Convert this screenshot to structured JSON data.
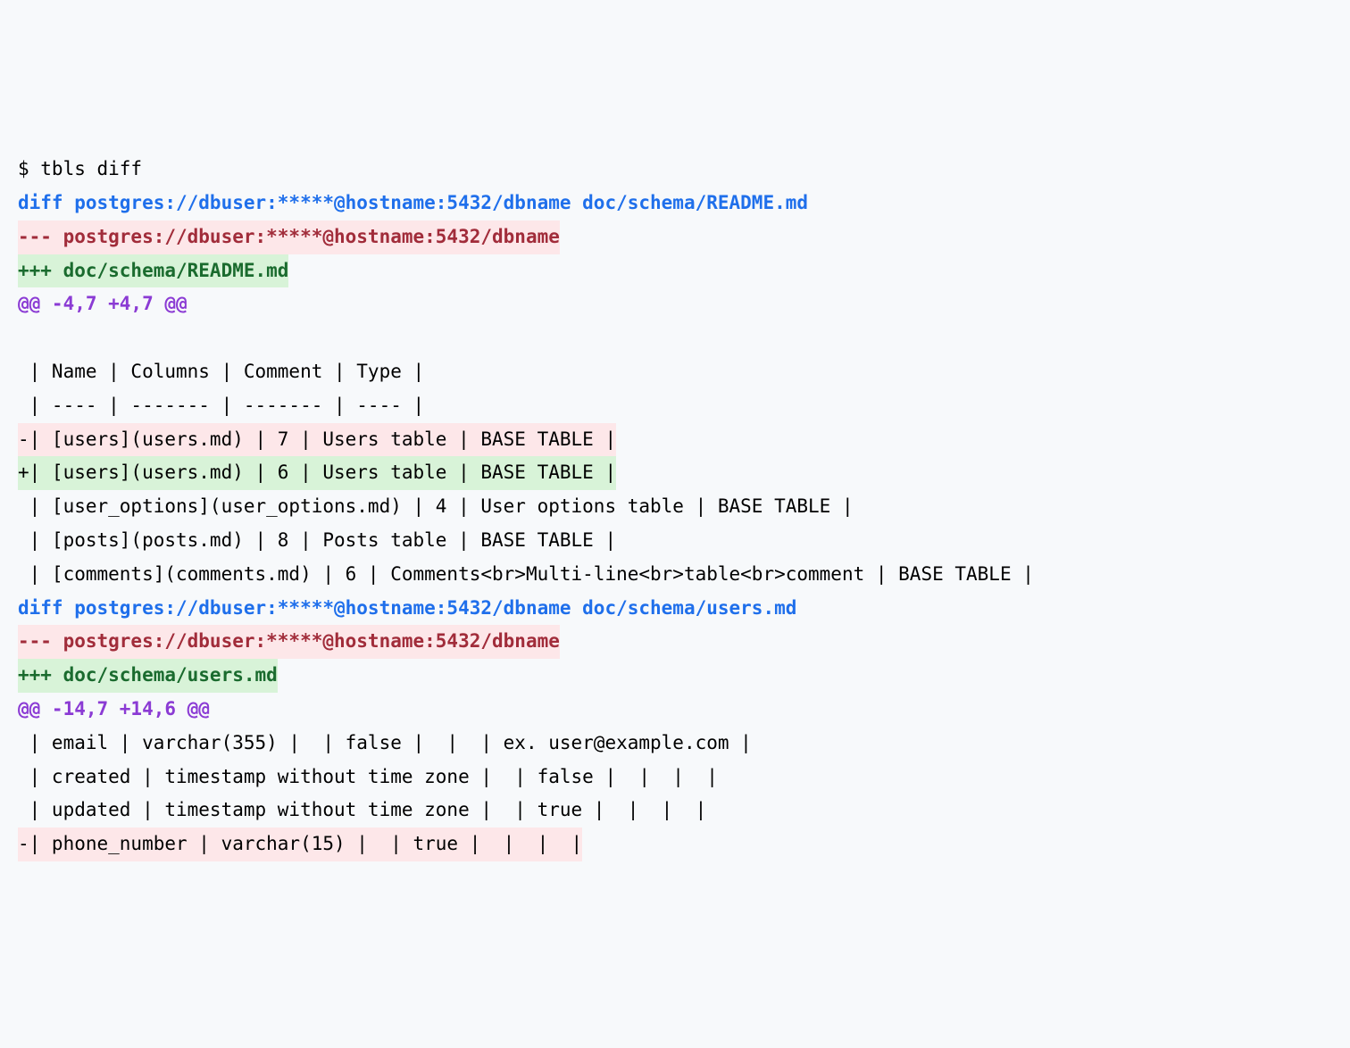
{
  "lines": [
    {
      "cls": "cmd",
      "text": "$ tbls diff"
    },
    {
      "cls": "diff-header",
      "text": "diff postgres://dbuser:*****@hostname:5432/dbname doc/schema/README.md"
    },
    {
      "cls": "diff-minus-file",
      "text": "--- postgres://dbuser:*****@hostname:5432/dbname"
    },
    {
      "cls": "diff-plus-file",
      "text": "+++ doc/schema/README.md"
    },
    {
      "cls": "hunk",
      "text": "@@ -4,7 +4,7 @@"
    },
    {
      "cls": "ctx",
      "text": " "
    },
    {
      "cls": "ctx",
      "text": " | Name | Columns | Comment | Type |"
    },
    {
      "cls": "ctx",
      "text": " | ---- | ------- | ------- | ---- |"
    },
    {
      "cls": "removed",
      "text": "-| [users](users.md) | 7 | Users table | BASE TABLE |"
    },
    {
      "cls": "added",
      "text": "+| [users](users.md) | 6 | Users table | BASE TABLE |"
    },
    {
      "cls": "ctx",
      "text": " | [user_options](user_options.md) | 4 | User options table | BASE TABLE |"
    },
    {
      "cls": "ctx",
      "text": " | [posts](posts.md) | 8 | Posts table | BASE TABLE |"
    },
    {
      "cls": "ctx",
      "text": " | [comments](comments.md) | 6 | Comments<br>Multi-line<br>table<br>comment | BASE TABLE |"
    },
    {
      "cls": "diff-header",
      "text": "diff postgres://dbuser:*****@hostname:5432/dbname doc/schema/users.md"
    },
    {
      "cls": "diff-minus-file",
      "text": "--- postgres://dbuser:*****@hostname:5432/dbname"
    },
    {
      "cls": "diff-plus-file",
      "text": "+++ doc/schema/users.md"
    },
    {
      "cls": "hunk",
      "text": "@@ -14,7 +14,6 @@"
    },
    {
      "cls": "ctx",
      "text": " | email | varchar(355) |  | false |  |  | ex. user@example.com |"
    },
    {
      "cls": "ctx",
      "text": " | created | timestamp without time zone |  | false |  |  |  |"
    },
    {
      "cls": "ctx",
      "text": " | updated | timestamp without time zone |  | true |  |  |  |"
    },
    {
      "cls": "removed",
      "text": "-| phone_number | varchar(15) |  | true |  |  |  |"
    }
  ]
}
